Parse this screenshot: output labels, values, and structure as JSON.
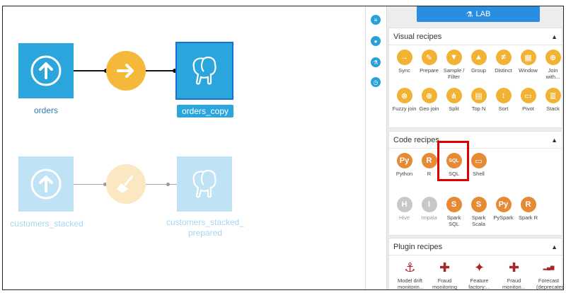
{
  "flow": {
    "datasets": [
      {
        "name": "orders"
      },
      {
        "name": "orders_copy"
      },
      {
        "name": "customers_stacked"
      },
      {
        "name": "customers_stacked_\nprepared"
      }
    ]
  },
  "panel": {
    "lab_label": "LAB",
    "visual": {
      "title": "Visual recipes",
      "items": [
        {
          "label": "Sync"
        },
        {
          "label": "Prepare"
        },
        {
          "label": "Sample /\nFilter"
        },
        {
          "label": "Group"
        },
        {
          "label": "Distinct"
        },
        {
          "label": "Window"
        },
        {
          "label": "Join\nwith..."
        },
        {
          "label": "Fuzzy join"
        },
        {
          "label": "Geo join"
        },
        {
          "label": "Split"
        },
        {
          "label": "Top N"
        },
        {
          "label": "Sort"
        },
        {
          "label": "Pivot"
        },
        {
          "label": "Stack"
        }
      ]
    },
    "code": {
      "title": "Code recipes",
      "items": [
        {
          "label": "Python"
        },
        {
          "label": "R"
        },
        {
          "label": "SQL"
        },
        {
          "label": "Shell"
        },
        {
          "label": "Hive"
        },
        {
          "label": "Impala"
        },
        {
          "label": "Spark SQL"
        },
        {
          "label": "Spark\nScala"
        },
        {
          "label": "PySpark"
        },
        {
          "label": "Spark R"
        }
      ]
    },
    "plugin": {
      "title": "Plugin recipes",
      "items": [
        {
          "label": "Model drift\nmonitorin..."
        },
        {
          "label": "Fraud\nmonitoring"
        },
        {
          "label": "Feature\nfactory:..."
        },
        {
          "label": "Fraud\nmonitori..."
        },
        {
          "label": "Forecast\n(deprecated)"
        }
      ]
    }
  },
  "colors": {
    "dataset": "#2aa6dd",
    "recipe": "#f4b93a",
    "highlight": "#e00000"
  }
}
